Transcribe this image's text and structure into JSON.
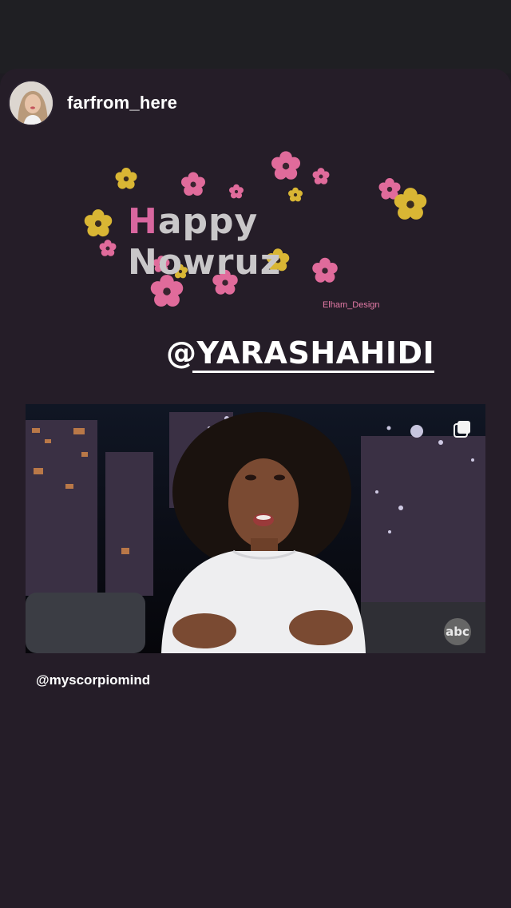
{
  "story": {
    "username": "farfrom_here",
    "greeting_first_letter": "H",
    "greeting_rest": "appy Nowruz",
    "designer_signature": "Elham_Design",
    "mention_at": "@",
    "mention_name": "YARASHAHIDI",
    "video_network_logo": "abc",
    "video_credit": "@myscorpiomind"
  },
  "icons": {
    "avatar": "profile-avatar",
    "multi_photo": "multiple-posts-icon"
  },
  "colors": {
    "background": "#251d28",
    "flower_pink": "#e06b9b",
    "flower_yellow": "#d9b634",
    "accent_text": "#d9669f"
  }
}
